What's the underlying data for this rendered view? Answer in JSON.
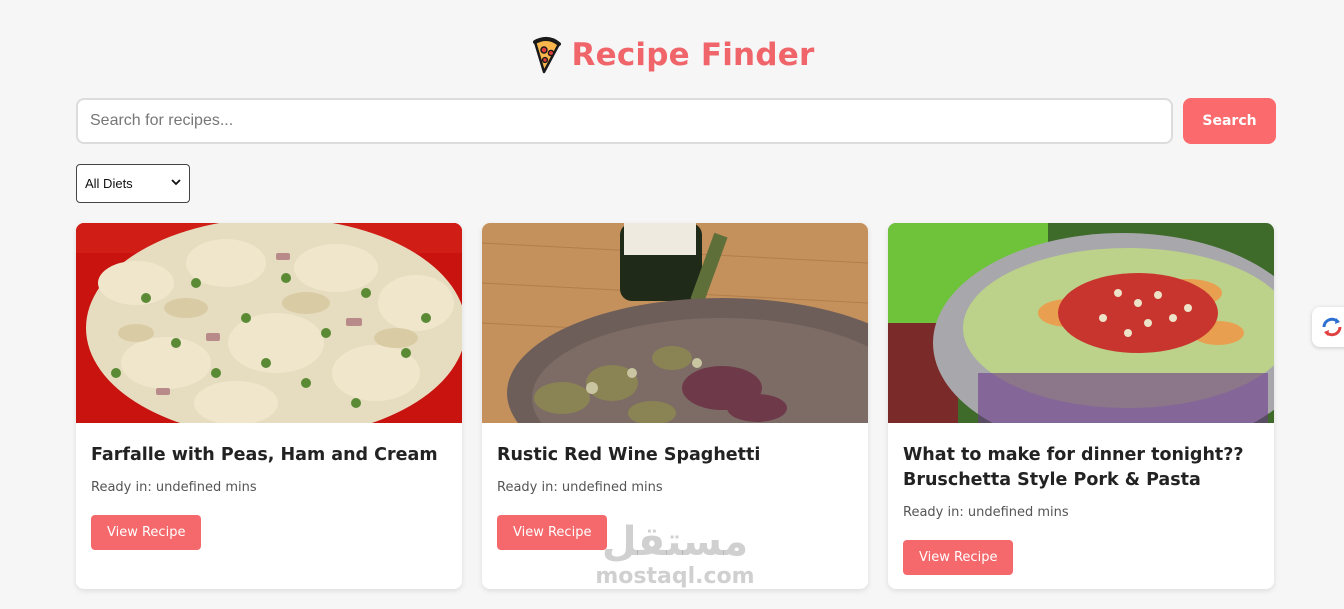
{
  "header": {
    "title": "Recipe Finder",
    "logo_icon": "pizza-slice-icon"
  },
  "search": {
    "placeholder": "Search for recipes...",
    "value": "",
    "button_label": "Search"
  },
  "filter": {
    "selected": "All Diets"
  },
  "colors": {
    "accent": "#f0656a",
    "button": "#fb6a6c",
    "background": "#f6f6f6"
  },
  "recipes": [
    {
      "title": "Farfalle with Peas, Ham and Cream",
      "ready": "Ready in: undefined mins",
      "button": "View Recipe"
    },
    {
      "title": "Rustic Red Wine Spaghetti",
      "ready": "Ready in: undefined mins",
      "button": "View Recipe"
    },
    {
      "title": "What to make for dinner tonight?? Bruschetta Style Pork & Pasta",
      "ready": "Ready in: undefined mins",
      "button": "View Recipe"
    }
  ],
  "watermark": {
    "arabic": "مستقل",
    "latin": "mostaql.com"
  }
}
